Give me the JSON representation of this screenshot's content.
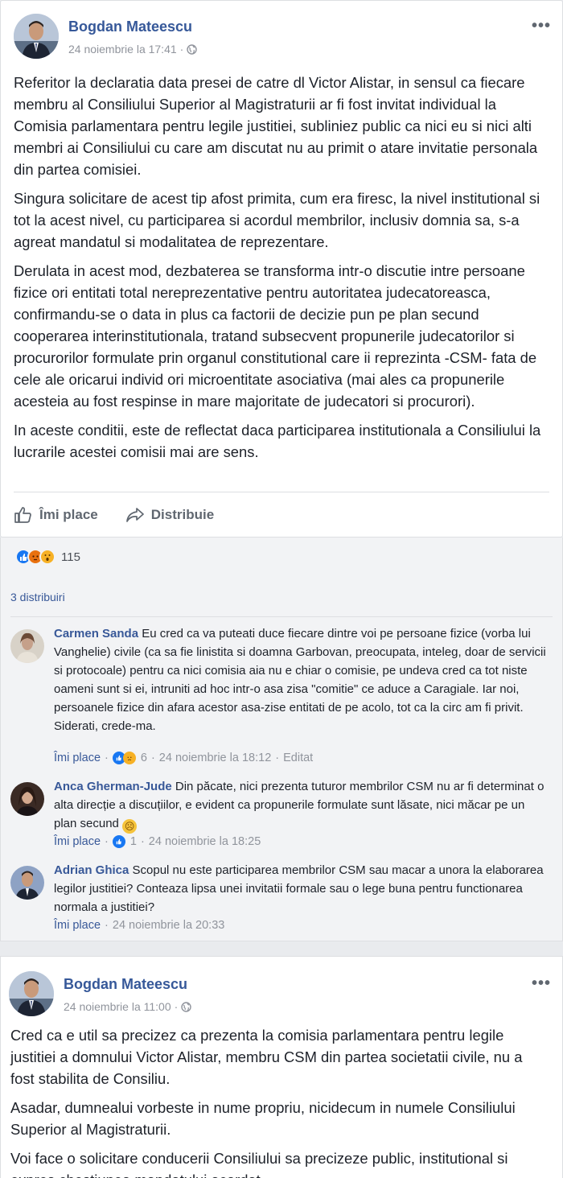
{
  "post1": {
    "author": "Bogdan Mateescu",
    "timestamp": "24 noiembrie la 17:41",
    "separator": "·",
    "more": "•••",
    "paragraphs": [
      "Referitor la declaratia data presei de catre dl Victor Alistar, in sensul ca fiecare membru al Consiliului Superior al Magistraturii ar fi fost invitat individual la Comisia parlamentara pentru legile justitiei, subliniez public ca nici eu si nici alti membri ai Consiliului cu care am discutat nu au primit o atare invitatie personala din partea comisiei.",
      "Singura solicitare de acest tip afost primita, cum era firesc, la nivel institutional si tot la acest nivel, cu participarea si acordul membrilor, inclusiv domnia sa, s-a agreat mandatul si modalitatea de reprezentare.",
      "Derulata in acest mod, dezbaterea se transforma intr-o discutie intre persoane fizice ori entitati total nereprezentative pentru autoritatea judecatoreasca, confirmandu-se o data in plus ca factorii de decizie pun pe plan secund cooperarea interinstitutionala, tratand subsecvent propunerile judecatorilor si procurorilor formulate prin organul constitutional care ii reprezinta -CSM- fata de cele ale oricarui individ ori microentitate asociativa (mai ales ca propunerile acesteia au fost respinse in mare majoritate de judecatori si procurori).",
      "In aceste conditii, este de reflectat daca participarea institutionala a Consiliului la lucrarile acestei comisii mai are sens."
    ],
    "like_label": "Îmi place",
    "share_label": "Distribuie",
    "reaction_count": "115",
    "shares_text": "3 distribuiri"
  },
  "comments": [
    {
      "name": "Carmen Sanda",
      "text": " Eu cred ca va puteati duce fiecare dintre voi pe persoane fizice (vorba lui Vanghelie) civile (ca sa fie linistita si doamna Garbovan, preocupata, inteleg, doar de servicii si protocoale) pentru ca nici comisia aia nu e chiar o comisie, pe undeva cred ca tot niste oameni sunt si ei, intruniti ad hoc intr-o asa zisa \"comitie\" ce aduce a Caragiale. Iar noi, persoanele fizice din afara acestor asa-zise entitati de pe acolo, tot ca la circ am fi privit. Siderati, crede-ma.",
      "like": "Îmi place",
      "count": "6",
      "time": "24 noiembrie la 18:12",
      "edited": "Editat"
    },
    {
      "name": "Anca Gherman-Jude",
      "text": " Din păcate, nici prezenta tuturor membrilor CSM nu ar fi determinat o alta direcție a discuțiilor, e evident ca propunerile formulate sunt lăsate, nici măcar pe un plan secund ",
      "like": "Îmi place",
      "count": "1",
      "time": "24 noiembrie la 18:25"
    },
    {
      "name": "Adrian Ghica",
      "text": " Scopul nu este participarea membrilor CSM sau macar a unora la elaborarea legilor justitiei? Conteaza lipsa unei invitatii formale sau o lege buna pentru functionarea normala a justitiei?",
      "like": "Îmi place",
      "time": "24 noiembrie la 20:33"
    }
  ],
  "post2": {
    "author": "Bogdan Mateescu",
    "timestamp": "24 noiembrie la 11:00",
    "separator": "·",
    "more": "•••",
    "paragraphs": [
      "Cred ca e util sa precizez ca prezenta la comisia parlamentara pentru legile justitiei a domnului Victor Alistar, membru CSM din partea societatii civile, nu a fost stabilita de Consiliu.",
      "Asadar, dumnealui vorbeste in nume propriu, nicidecum in numele Consiliului Superior al Magistraturii.",
      "Voi face o solicitare conducerii Consiliului sa precizeze public, institutional si expres chestiunea mandatului acordat."
    ]
  },
  "dot": "·",
  "colors": {
    "link": "#365899",
    "meta": "#90949c",
    "like_blue": "#1877f2",
    "angry": "#e9710f",
    "wow": "#f7b125"
  }
}
